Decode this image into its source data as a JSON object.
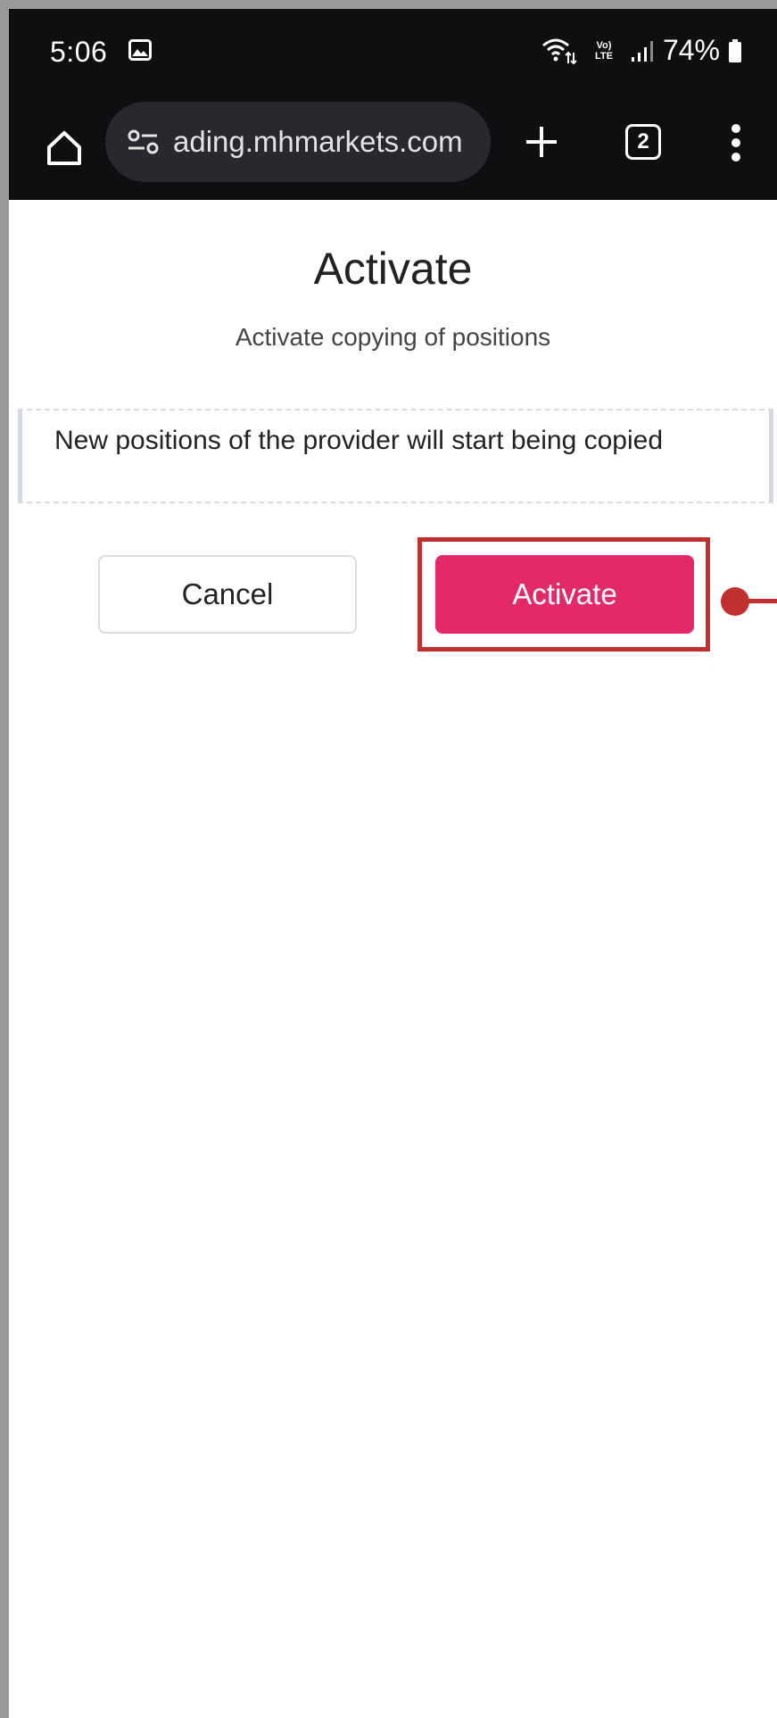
{
  "status_bar": {
    "time": "5:06",
    "battery": "74%",
    "network_top": "Vo)",
    "network_bottom": "LTE"
  },
  "browser": {
    "url": "ading.mhmarkets.com",
    "tab_count": "2"
  },
  "dialog": {
    "title": "Activate",
    "subtitle": "Activate copying of positions",
    "notice": "New positions of the provider will start being copied",
    "cancel_label": "Cancel",
    "activate_label": "Activate"
  },
  "colors": {
    "activate_button": "#e32a66",
    "annotation": "#c0302e",
    "browser_chrome": "#0f0f11",
    "url_pill": "#28292f"
  },
  "icons": [
    "gallery-icon",
    "wifi-icon",
    "signal-icon",
    "battery-icon",
    "home-icon",
    "site-settings-icon",
    "plus-icon",
    "tabs-icon",
    "more-vert-icon"
  ]
}
